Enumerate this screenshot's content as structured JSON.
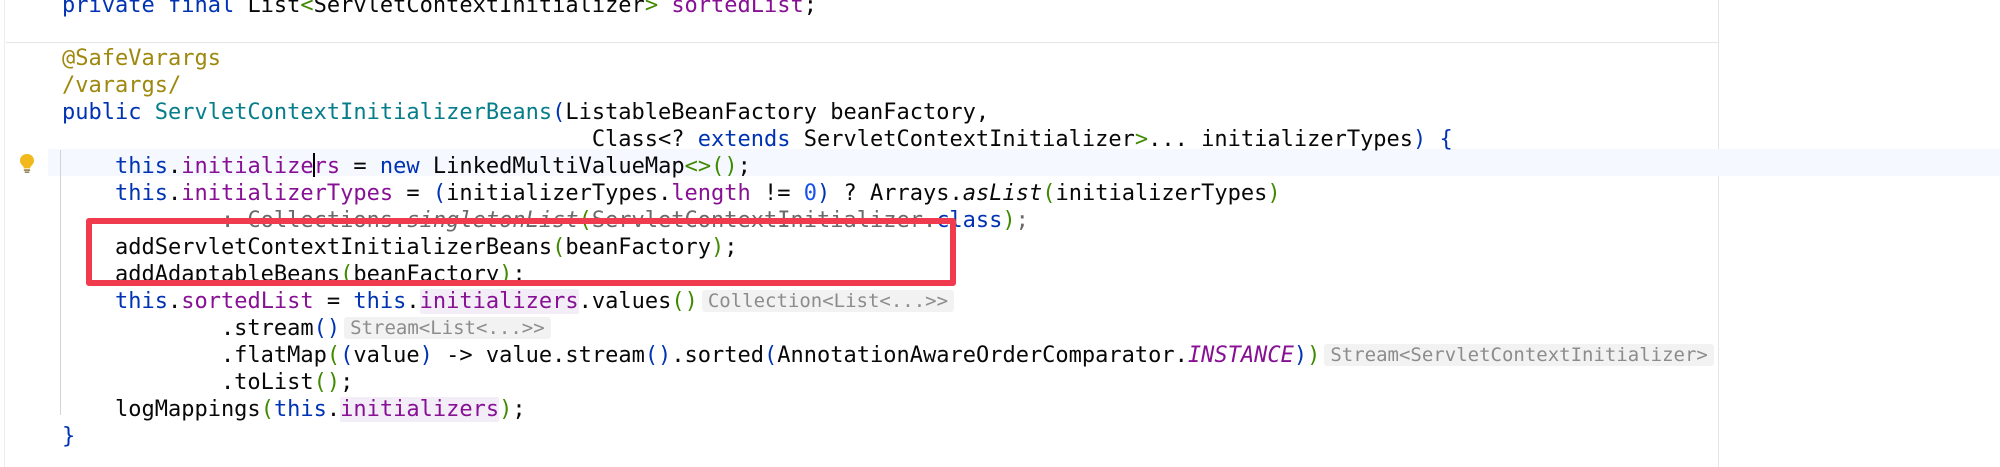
{
  "editor": {
    "lines": [
      {
        "id": "field-decl",
        "tokens": [
          {
            "t": "private final ",
            "c": "kw"
          },
          {
            "t": "List"
          },
          {
            "t": "<",
            "c": "pb"
          },
          {
            "t": "ServletContextInitializer"
          },
          {
            "t": ">",
            "c": "pb"
          },
          {
            "t": " "
          },
          {
            "t": "sortedList",
            "c": "fld"
          },
          {
            "t": ";"
          }
        ]
      },
      {
        "id": "annotation-safevarargs",
        "tokens": [
          {
            "t": "@SafeVarargs",
            "c": "ann"
          }
        ]
      },
      {
        "id": "comment-varargs",
        "tokens": [
          {
            "t": "/varargs/",
            "c": "ann"
          }
        ]
      },
      {
        "id": "constructor-signature",
        "tokens": [
          {
            "t": "public ",
            "c": "kw"
          },
          {
            "t": "ServletContextInitializerBeans",
            "c": "type"
          },
          {
            "t": "(",
            "c": "kw"
          },
          {
            "t": "ListableBeanFactory beanFactory,"
          }
        ]
      },
      {
        "id": "constructor-signature-cont",
        "tokens": [
          {
            "t": "                                        "
          },
          {
            "t": "Class<? "
          },
          {
            "t": "extends ",
            "c": "kw"
          },
          {
            "t": "ServletContextInitializer"
          },
          {
            "t": ">",
            "c": "pb"
          },
          {
            "t": "... initializerTypes"
          },
          {
            "t": ") {",
            "c": "kw"
          }
        ]
      },
      {
        "id": "line-initializers-assign",
        "tokens": [
          {
            "t": "    "
          },
          {
            "t": "this",
            "c": "kw"
          },
          {
            "t": "."
          },
          {
            "t": "initialize",
            "c": "fld"
          },
          {
            "t": "|caret|"
          },
          {
            "t": "rs",
            "c": "fld"
          },
          {
            "t": " = "
          },
          {
            "t": "new ",
            "c": "kw"
          },
          {
            "t": "LinkedMultiValueMap"
          },
          {
            "t": "<>",
            "c": "pb"
          },
          {
            "t": "()",
            "c": "pb"
          },
          {
            "t": ";"
          }
        ]
      },
      {
        "id": "line-initializer-types",
        "tokens": [
          {
            "t": "    "
          },
          {
            "t": "this",
            "c": "kw"
          },
          {
            "t": "."
          },
          {
            "t": "initializerTypes",
            "c": "fld"
          },
          {
            "t": " = "
          },
          {
            "t": "(",
            "c": "kw"
          },
          {
            "t": "initializerTypes."
          },
          {
            "t": "length",
            "c": "fld"
          },
          {
            "t": " != "
          },
          {
            "t": "0",
            "c": "num"
          },
          {
            "t": ")",
            "c": "kw"
          },
          {
            "t": " ? Arrays."
          },
          {
            "t": "asList",
            "c": "italic"
          },
          {
            "t": "(",
            "c": "pb"
          },
          {
            "t": "initializerTypes"
          },
          {
            "t": ")",
            "c": "pb"
          }
        ]
      },
      {
        "id": "line-singleton",
        "tokens": [
          {
            "t": "            : Collections."
          },
          {
            "t": "singletonList",
            "c": "italic"
          },
          {
            "t": "(",
            "c": "pb"
          },
          {
            "t": "ServletContextInitializer."
          },
          {
            "t": "class",
            "c": "kw"
          },
          {
            "t": ")",
            "c": "pb"
          },
          {
            "t": ";"
          }
        ]
      },
      {
        "id": "line-add-servlet-beans",
        "tokens": [
          {
            "t": "    addServletContextInitializerBeans"
          },
          {
            "t": "(",
            "c": "pb"
          },
          {
            "t": "beanFactory"
          },
          {
            "t": ")",
            "c": "pb"
          },
          {
            "t": ";"
          }
        ]
      },
      {
        "id": "line-add-adaptable-beans",
        "tokens": [
          {
            "t": "    addAdaptableBeans"
          },
          {
            "t": "(",
            "c": "pb"
          },
          {
            "t": "beanFactory"
          },
          {
            "t": ")",
            "c": "pb"
          },
          {
            "t": ";"
          }
        ]
      },
      {
        "id": "line-sorted-list",
        "tokens": [
          {
            "t": "    "
          },
          {
            "t": "this",
            "c": "kw"
          },
          {
            "t": "."
          },
          {
            "t": "sortedList",
            "c": "fld"
          },
          {
            "t": " = "
          },
          {
            "t": "this",
            "c": "kw"
          },
          {
            "t": "."
          },
          {
            "t": "initializers",
            "c": "fld hl-init"
          },
          {
            "t": ".values"
          },
          {
            "t": "()",
            "c": "pb"
          },
          {
            "t": "|hint|Collection<List<...>>"
          }
        ]
      },
      {
        "id": "line-stream",
        "tokens": [
          {
            "t": "            .stream"
          },
          {
            "t": "()",
            "c": "kw"
          },
          {
            "t": "|hint|Stream<List<...>>"
          }
        ]
      },
      {
        "id": "line-flatmap",
        "tokens": [
          {
            "t": "            .flatMap"
          },
          {
            "t": "(",
            "c": "pb"
          },
          {
            "t": "(",
            "c": "kw"
          },
          {
            "t": "value"
          },
          {
            "t": ")",
            "c": "kw"
          },
          {
            "t": " -> value.stream"
          },
          {
            "t": "()",
            "c": "kw"
          },
          {
            "t": ".sorted"
          },
          {
            "t": "(",
            "c": "kw"
          },
          {
            "t": "AnnotationAwareOrderComparator."
          },
          {
            "t": "INSTANCE",
            "c": "italic-static"
          },
          {
            "t": ")",
            "c": "kw"
          },
          {
            "t": ")",
            "c": "pb"
          },
          {
            "t": "|hint|Stream<ServletContextInitializer>"
          }
        ]
      },
      {
        "id": "line-tolist",
        "tokens": [
          {
            "t": "            .toList"
          },
          {
            "t": "()",
            "c": "pb"
          },
          {
            "t": ";"
          }
        ]
      },
      {
        "id": "line-log-mappings",
        "tokens": [
          {
            "t": "    logMappings"
          },
          {
            "t": "(",
            "c": "pb"
          },
          {
            "t": "this",
            "c": "kw"
          },
          {
            "t": "."
          },
          {
            "t": "initializers",
            "c": "fld hl-init"
          },
          {
            "t": ")",
            "c": "pb"
          },
          {
            "t": ";"
          }
        ]
      },
      {
        "id": "line-close-brace",
        "tokens": [
          {
            "t": "}",
            "c": "kw"
          }
        ]
      }
    ]
  },
  "icons": {
    "intention_bulb": "lightbulb-icon"
  },
  "colors": {
    "keyword": "#0033b3",
    "type": "#067d8a",
    "field": "#871094",
    "annotation": "#9e880d",
    "highlight_box": "#f03a4d"
  }
}
